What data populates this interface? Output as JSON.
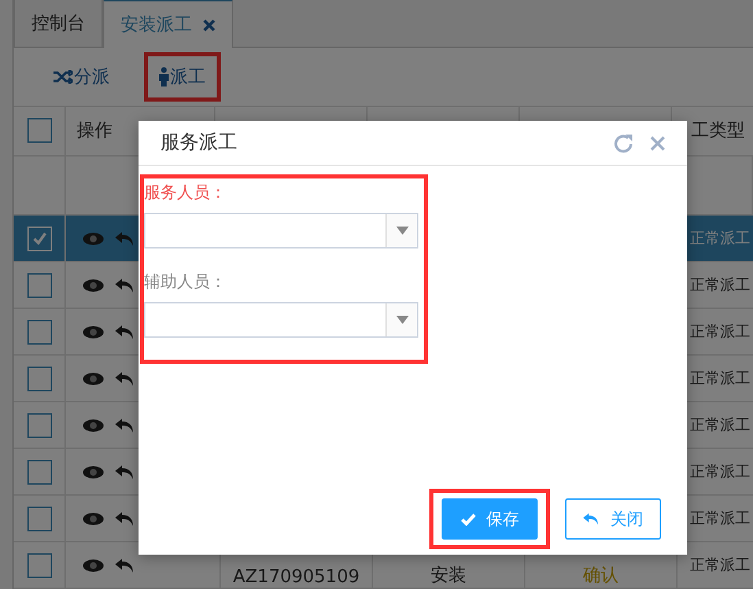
{
  "tabs": [
    {
      "label": "控制台",
      "selected": false,
      "closable": false
    },
    {
      "label": "安装派工",
      "selected": true,
      "closable": true
    }
  ],
  "toolbar": [
    {
      "label": "分派",
      "kind": "shuffle",
      "highlighted": false
    },
    {
      "label": "派工",
      "kind": "person",
      "highlighted": true
    }
  ],
  "table": {
    "all_checked": false,
    "columns": [
      "操作",
      "工类型"
    ],
    "rows": [
      {
        "selected": true,
        "type": "正常派工"
      },
      {
        "selected": false,
        "type": "正常派工"
      },
      {
        "selected": false,
        "type": "正常派工"
      },
      {
        "selected": false,
        "type": "正常派工"
      },
      {
        "selected": false,
        "type": "正常派工"
      },
      {
        "selected": false,
        "type": "正常派工"
      },
      {
        "selected": false,
        "type": "正常派工"
      },
      {
        "selected": false,
        "type": "正常派工",
        "order": "AZ170905109",
        "service": "安装",
        "status": "确认"
      }
    ]
  },
  "dialog": {
    "title": "服务派工",
    "fields": [
      {
        "label": "服务人员：",
        "required": true
      },
      {
        "label": "辅助人员：",
        "required": false
      }
    ],
    "buttons": [
      {
        "label": "保存",
        "kind": "primary",
        "highlighted": true
      },
      {
        "label": "关闭",
        "kind": "secondary",
        "highlighted": false
      }
    ]
  }
}
